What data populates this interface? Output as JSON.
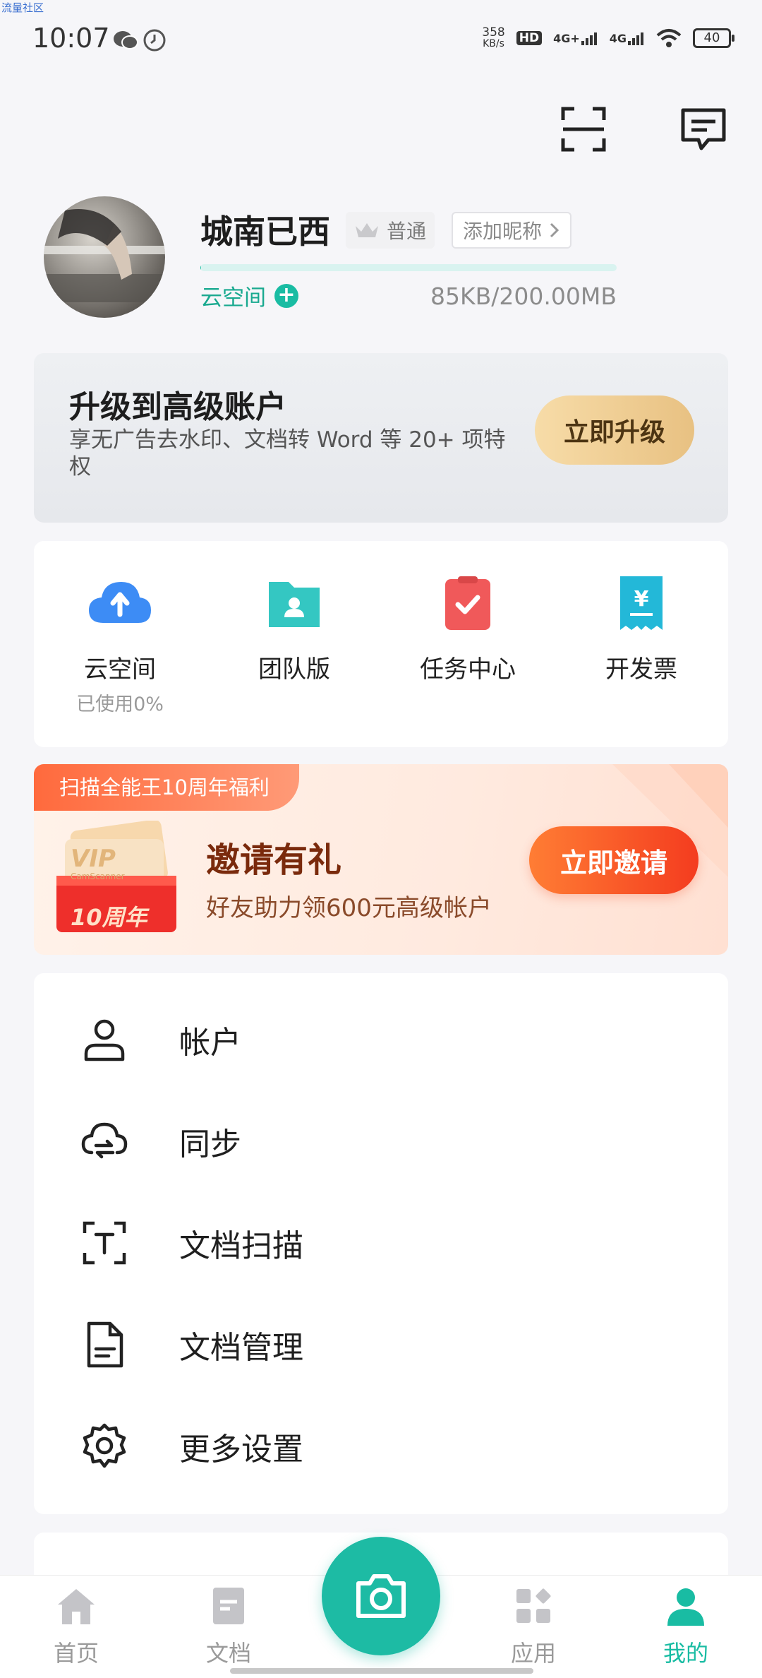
{
  "watermark": "流量社区",
  "status_bar": {
    "time": "10:07",
    "net_speed": "358",
    "net_unit": "KB/s",
    "hd": "HD",
    "net1": "4G+",
    "net2": "4G",
    "battery": "40"
  },
  "header": {
    "scan_icon": "scan-frame-icon",
    "message_icon": "message-icon"
  },
  "profile": {
    "username": "城南已西",
    "level": "普通",
    "add_nickname": "添加昵称",
    "cloud_label": "云空间",
    "storage": "85KB/200.00MB",
    "storage_used_fraction": 0.0004
  },
  "upgrade": {
    "title": "升级到高级账户",
    "subtitle": "享无广告去水印、文档转 Word 等 20+ 项特权",
    "button": "立即升级"
  },
  "quick": [
    {
      "label": "云空间",
      "sub": "已使用0%",
      "icon": "cloud-upload-icon",
      "color": "#3d8cf5"
    },
    {
      "label": "团队版",
      "sub": "",
      "icon": "team-folder-icon",
      "color": "#34c7c2"
    },
    {
      "label": "任务中心",
      "sub": "",
      "icon": "task-check-icon",
      "color": "#f0595a"
    },
    {
      "label": "开发票",
      "sub": "",
      "icon": "invoice-icon",
      "color": "#23b8d8"
    }
  ],
  "invite": {
    "tag": "扫描全能王10周年福利",
    "title": "邀请有礼",
    "subtitle": "好友助力领600元高级帐户",
    "button": "立即邀请",
    "art_text": "VIP",
    "art_brand": "CamScanner",
    "art_badge": "10周年"
  },
  "menu": [
    {
      "label": "帐户",
      "icon": "user-icon"
    },
    {
      "label": "同步",
      "icon": "cloud-sync-icon"
    },
    {
      "label": "文档扫描",
      "icon": "text-scan-icon"
    },
    {
      "label": "文档管理",
      "icon": "document-icon"
    },
    {
      "label": "更多设置",
      "icon": "gear-icon"
    }
  ],
  "tabs": [
    {
      "label": "首页",
      "icon": "home-icon",
      "active": false
    },
    {
      "label": "文档",
      "icon": "doc-tab-icon",
      "active": false
    },
    {
      "label": "应用",
      "icon": "apps-icon",
      "active": false
    },
    {
      "label": "我的",
      "icon": "profile-icon",
      "active": true
    }
  ],
  "colors": {
    "accent": "#19bca3",
    "invite_orange": "#f4532a",
    "upgrade_gold": "#e8c182"
  }
}
